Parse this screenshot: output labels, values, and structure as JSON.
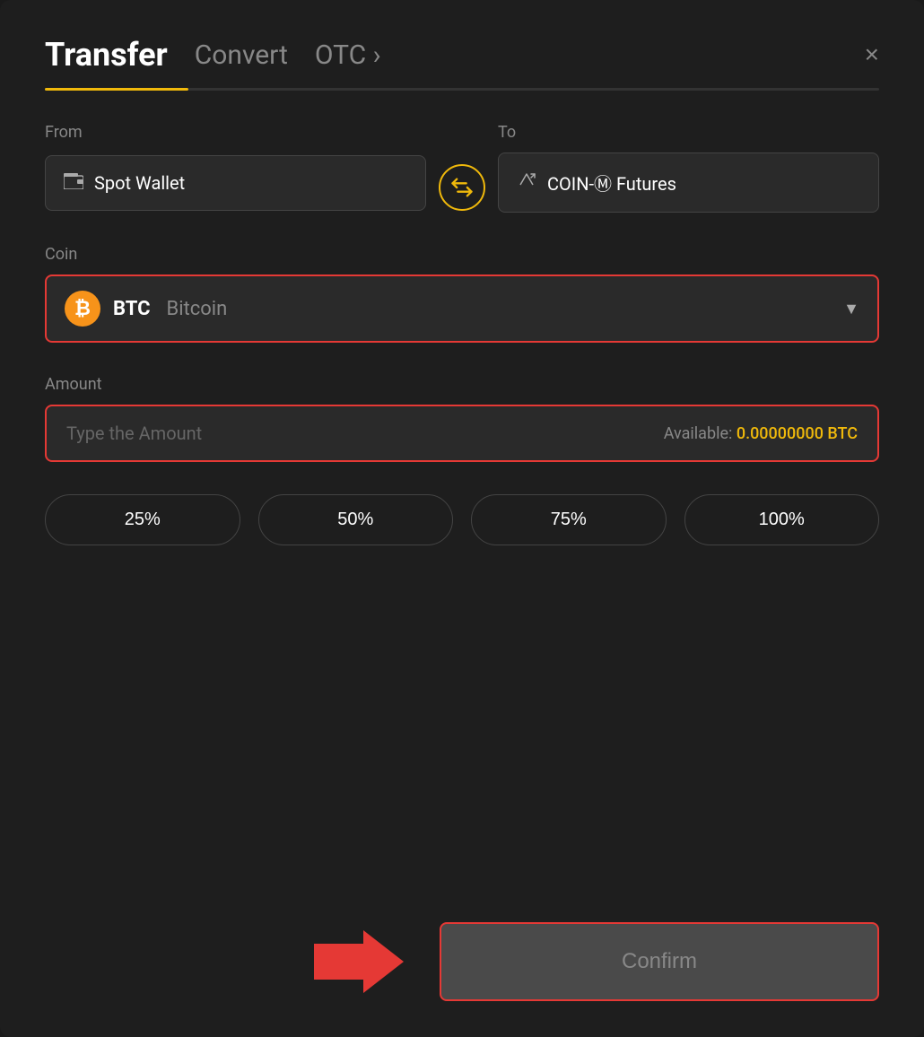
{
  "header": {
    "title": "Transfer",
    "tab_convert": "Convert",
    "tab_otc": "OTC ›",
    "close_label": "×"
  },
  "from": {
    "label": "From",
    "wallet_name": "Spot Wallet"
  },
  "to": {
    "label": "To",
    "wallet_name": "COIN-Ⓜ Futures"
  },
  "coin": {
    "label": "Coin",
    "symbol": "BTC",
    "full_name": "Bitcoin"
  },
  "amount": {
    "label": "Amount",
    "placeholder": "Type the Amount",
    "available_label": "Available:",
    "available_value": "0.00000000 BTC"
  },
  "percentage_buttons": [
    {
      "label": "25%"
    },
    {
      "label": "50%"
    },
    {
      "label": "75%"
    },
    {
      "label": "100%"
    }
  ],
  "confirm_button": {
    "label": "Confirm"
  },
  "colors": {
    "accent": "#f0b90b",
    "danger_border": "#e53935",
    "bg_modal": "#1e1e1e",
    "bg_box": "#2a2a2a",
    "text_muted": "#888888",
    "text_white": "#ffffff"
  }
}
